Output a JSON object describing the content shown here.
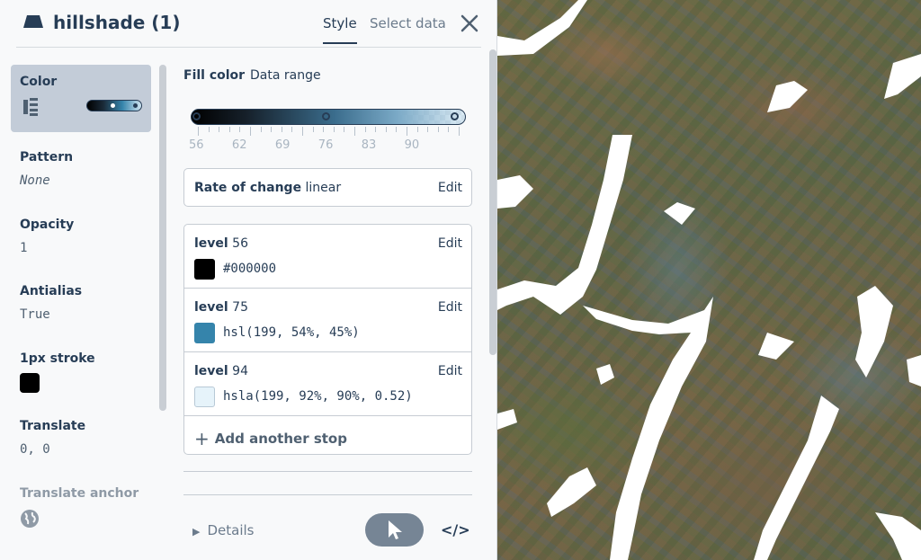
{
  "header": {
    "layer_name": "hillshade (1)",
    "tabs": [
      "Style",
      "Select data"
    ],
    "active_tab": "Style",
    "icon": "fill-layer-icon",
    "close_icon": "close-icon"
  },
  "properties": [
    {
      "label": "Color",
      "value": "",
      "selected": true
    },
    {
      "label": "Pattern",
      "value": "None"
    },
    {
      "label": "Opacity",
      "value": "1"
    },
    {
      "label": "Antialias",
      "value": "True"
    },
    {
      "label": "1px stroke",
      "value": "",
      "swatch": "#000000"
    },
    {
      "label": "Translate",
      "value": "0, 0"
    },
    {
      "label": "Translate anchor",
      "value": "",
      "icon": "globe-icon"
    }
  ],
  "fill": {
    "label": "Fill color",
    "mode": "Data range",
    "ramp_ticks": [
      "56",
      "62",
      "69",
      "76",
      "83",
      "90"
    ],
    "rate_of_change_label": "Rate of change",
    "rate_of_change_value": "linear",
    "edit_label": "Edit",
    "stops": [
      {
        "level_label": "level",
        "level": "56",
        "color": "#000000",
        "swatch": "#000000"
      },
      {
        "level_label": "level",
        "level": "75",
        "color": "hsl(199, 54%, 45%)",
        "swatch": "#3584ab"
      },
      {
        "level_label": "level",
        "level": "94",
        "color": "hsla(199, 92%, 90%, 0.52)",
        "swatch": "#e6f3fa"
      }
    ],
    "add_stop_label": "Add another stop"
  },
  "footer": {
    "details_label": "Details",
    "pick_icon": "cursor-arrow-icon",
    "code_label": "</>"
  },
  "colors": {
    "text_primary": "#273d56",
    "selected_bg": "#c3ccd8",
    "panel_bg": "#f8f9fa"
  }
}
